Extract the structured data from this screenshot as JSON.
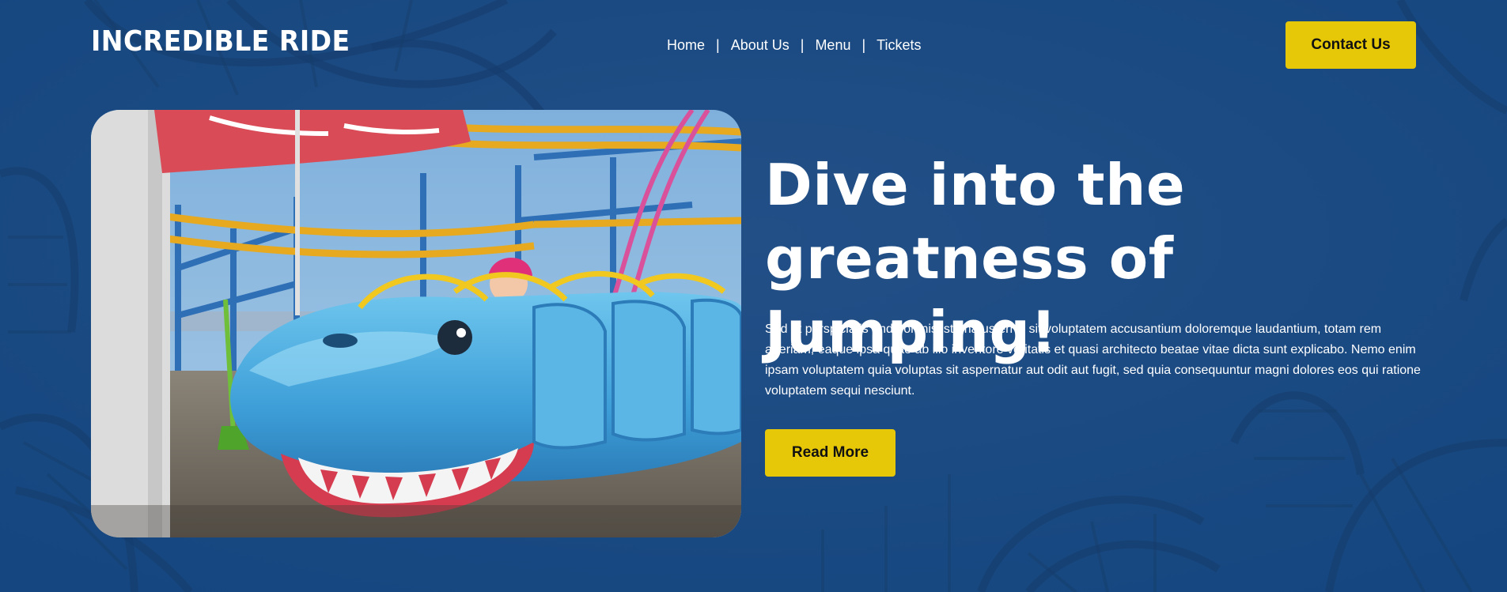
{
  "brand": {
    "name": "INCREDIBLE RIDE"
  },
  "nav": {
    "items": [
      {
        "label": "Home"
      },
      {
        "label": "About Us"
      },
      {
        "label": "Menu"
      },
      {
        "label": "Tickets"
      }
    ],
    "separator": "|"
  },
  "header": {
    "cta_label": "Contact Us"
  },
  "hero": {
    "title": "Dive into the greatness of Jumping!",
    "body": "Sed ut perspiciatis unde omnis iste natus error sit voluptatem accusantium doloremque laudantium, totam rem aperiam, eaque ipsa quae ab illo inventore veritatis et quasi architecto beatae vitae dicta sunt explicabo. Nemo enim ipsam voluptatem quia voluptas sit aspernatur aut odit aut fugit, sed quia consequuntur magni dolores eos qui ratione voluptatem sequi nesciunt.",
    "button_label": "Read More",
    "image_subject": "shark-shaped roller coaster car with a child"
  },
  "colors": {
    "background": "#1a4a84",
    "accent_button": "#e6c809",
    "text": "#ffffff",
    "button_text": "#111111"
  }
}
